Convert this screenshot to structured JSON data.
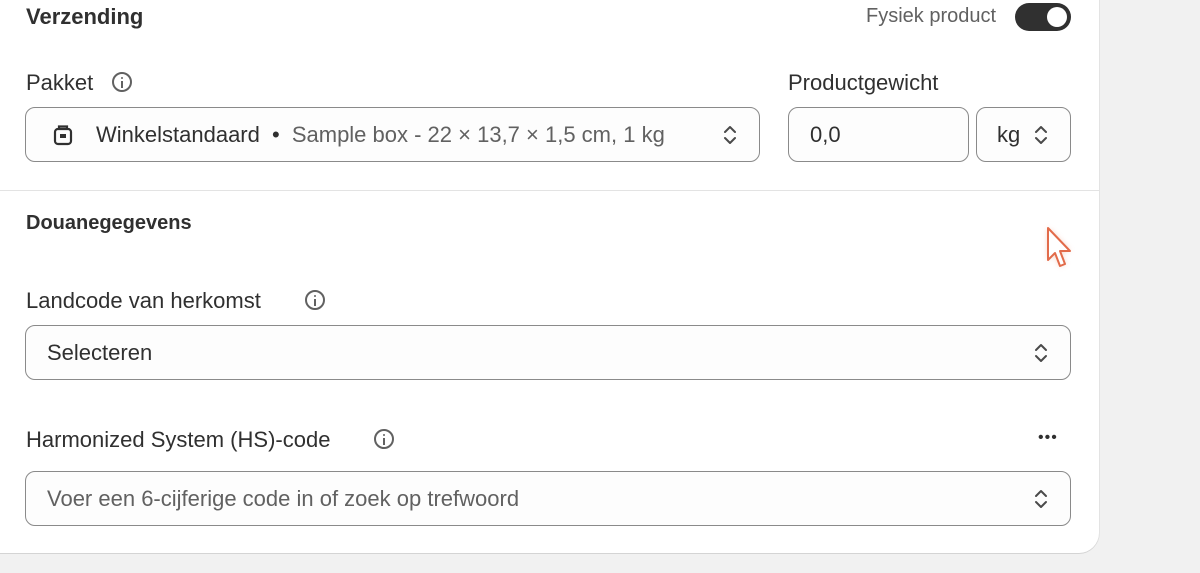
{
  "shipping": {
    "title": "Verzending",
    "physical_label": "Fysiek product",
    "physical_enabled": true,
    "package_label": "Pakket",
    "package_name": "Winkelstandaard",
    "package_separator": "•",
    "package_detail": "Sample box - 22 × 13,7 × 1,5 cm, 1 kg",
    "weight_label": "Productgewicht",
    "weight_value": "0,0",
    "weight_unit": "kg"
  },
  "customs": {
    "title": "Douanegegevens",
    "origin_label": "Landcode van herkomst",
    "origin_placeholder": "Selecteren",
    "hs_label": "Harmonized System (HS)-code",
    "hs_placeholder": "Voer een 6-cijferige code in of zoek op trefwoord",
    "more_label": "•••"
  }
}
